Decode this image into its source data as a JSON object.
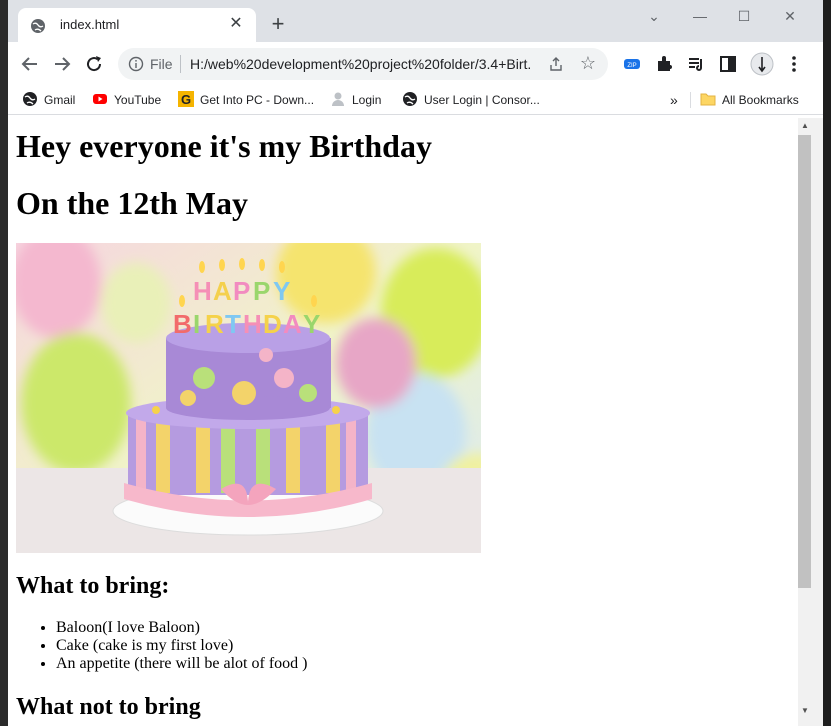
{
  "browser": {
    "tab_title": "index.html",
    "new_tab_symbol": "+",
    "url_scheme": "File",
    "url": "H:/web%20development%20project%20folder/3.4+Birt...",
    "icons": {
      "favicon": "globe-icon",
      "back": "back-arrow-icon",
      "forward": "forward-arrow-icon",
      "reload": "reload-icon",
      "info": "info-icon",
      "share": "share-icon",
      "bookmark_star": "star-icon",
      "extension_zip": "zip-extension-icon",
      "extensions": "puzzle-icon",
      "reading_list": "reading-list-icon",
      "side_panel": "side-panel-icon",
      "profile": "profile-avatar-icon",
      "menu": "kebab-menu-icon"
    }
  },
  "bookmarks": {
    "items": [
      {
        "label": "Gmail",
        "icon": "globe-icon"
      },
      {
        "label": "YouTube",
        "icon": "youtube-icon"
      },
      {
        "label": "Get Into PC - Down...",
        "icon": "getintopc-icon"
      },
      {
        "label": "Login",
        "icon": "user-icon"
      },
      {
        "label": "User Login | Consor...",
        "icon": "globe-icon"
      }
    ],
    "overflow": "»",
    "all_bookmarks": "All Bookmarks"
  },
  "page": {
    "heading1": "Hey everyone it's my Birthday",
    "heading2": "On the 12th May",
    "image_alt": "Happy Birthday cake",
    "image_letters": "HAPPY BIRTHDAY",
    "bring_heading": "What to bring:",
    "bring_list": [
      "Baloon(I love Baloon)",
      "Cake (cake is my first love)",
      "An appetite (there will be alot of food )"
    ],
    "not_bring_heading": "What not to bring"
  },
  "colors": {
    "tabstrip": "#dee1e6",
    "omnibox": "#f1f3f4",
    "youtube_red": "#ff0000",
    "getintopc_yellow": "#f5b400"
  }
}
